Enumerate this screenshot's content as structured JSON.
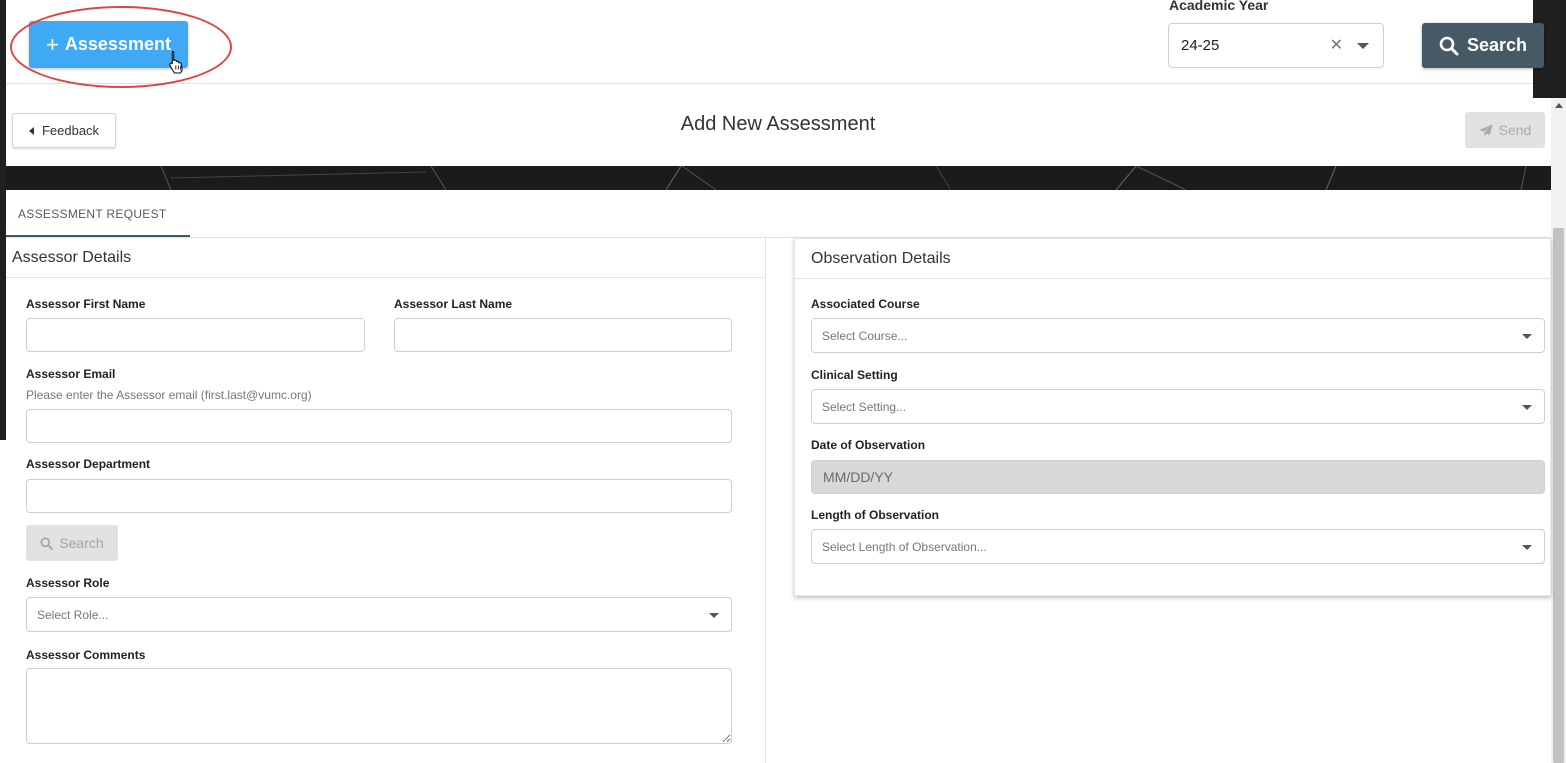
{
  "toolbar": {
    "add_assessment_label": "Assessment",
    "add_icon": "plus-icon",
    "academic_year_label": "Academic Year",
    "academic_year_value": "24-25",
    "clear_glyph": "✕",
    "search_label": "Search",
    "search_icon": "search-icon"
  },
  "modal": {
    "feedback_label": "Feedback",
    "title": "Add New Assessment",
    "send_label": "Send",
    "send_icon": "paper-plane-icon",
    "tabs": [
      {
        "label": "ASSESSMENT REQUEST",
        "active": true
      }
    ]
  },
  "assessor": {
    "heading": "Assessor Details",
    "first_name_label": "Assessor First Name",
    "first_name_value": "",
    "last_name_label": "Assessor Last Name",
    "last_name_value": "",
    "email_label": "Assessor Email",
    "email_hint": "Please enter the Assessor email (first.last@vumc.org)",
    "email_value": "",
    "department_label": "Assessor Department",
    "department_value": "",
    "search_label": "Search",
    "role_label": "Assessor Role",
    "role_placeholder": "Select Role...",
    "comments_label": "Assessor Comments",
    "comments_value": ""
  },
  "observation": {
    "heading": "Observation Details",
    "course_label": "Associated Course",
    "course_placeholder": "Select Course...",
    "setting_label": "Clinical Setting",
    "setting_placeholder": "Select Setting...",
    "date_label": "Date of Observation",
    "date_placeholder": "MM/DD/YY",
    "length_label": "Length of Observation",
    "length_placeholder": "Select Length of Observation..."
  },
  "colors": {
    "primary_button": "#3fa9f5",
    "dark_button": "#465a66",
    "highlight_ring": "#e04545",
    "disabled_button": "#e2e2e2"
  }
}
